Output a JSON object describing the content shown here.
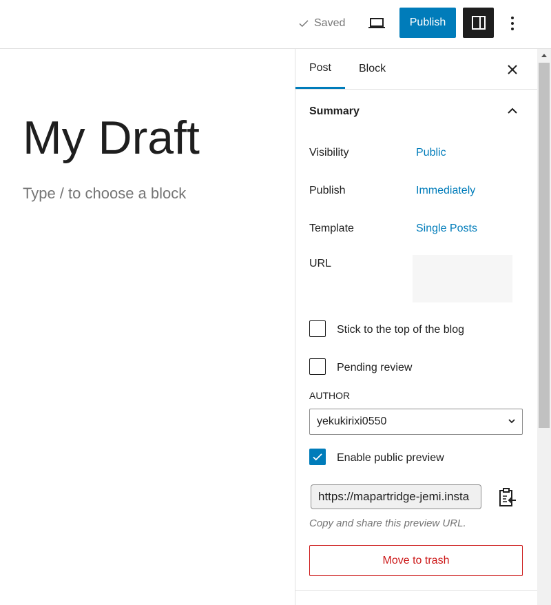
{
  "topbar": {
    "saved_label": "Saved",
    "publish_label": "Publish"
  },
  "editor": {
    "title": "My Draft",
    "block_placeholder": "Type / to choose a block"
  },
  "sidebar": {
    "tabs": [
      {
        "label": "Post",
        "active": true
      },
      {
        "label": "Block",
        "active": false
      }
    ],
    "summary": {
      "title": "Summary",
      "rows": [
        {
          "label": "Visibility",
          "value": "Public"
        },
        {
          "label": "Publish",
          "value": "Immediately"
        },
        {
          "label": "Template",
          "value": "Single Posts"
        },
        {
          "label": "URL",
          "value": ""
        }
      ],
      "stick_to_top": {
        "label": "Stick to the top of the blog",
        "checked": false
      },
      "pending_review": {
        "label": "Pending review",
        "checked": false
      },
      "author": {
        "label": "AUTHOR",
        "value": "yekukirixi0550"
      },
      "public_preview": {
        "label": "Enable public preview",
        "checked": true
      },
      "preview_url": "https://mapartridge-jemi.insta",
      "preview_help": "Copy and share this preview URL.",
      "trash_label": "Move to trash"
    }
  },
  "colors": {
    "accent": "#007cba",
    "danger": "#cc1818",
    "text": "#1e1e1e",
    "muted": "#757575",
    "border": "#e0e0e0"
  }
}
